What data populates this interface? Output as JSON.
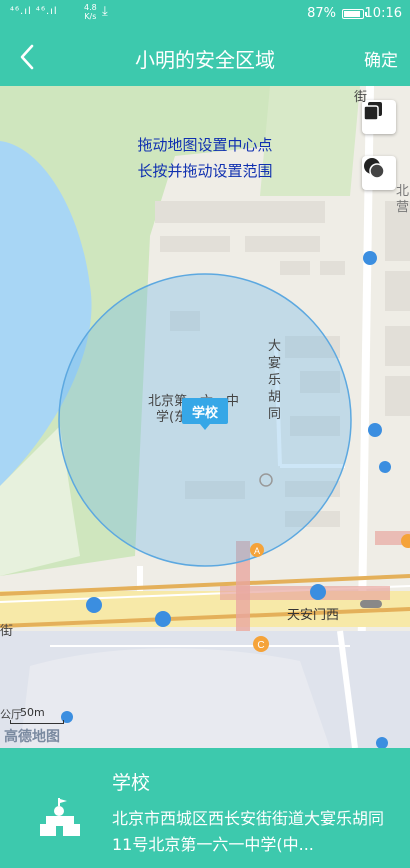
{
  "status_bar": {
    "signal": "⁴⁶.ıl ⁴⁶.ıl",
    "net_speed": "4.8",
    "net_unit": "K/s",
    "battery": "87%",
    "time": "10:16"
  },
  "header": {
    "back_icon": "<",
    "title": "小明的安全区域",
    "confirm": "确定"
  },
  "map": {
    "hint_line1": "拖动地图设置中心点",
    "hint_line2": "长按并拖动设置范围",
    "school_label": "学校",
    "poi_name_line1": "北京第一六一中",
    "poi_name_line2": "学(东)",
    "street_vertical": "大宴乐胡同",
    "street_main": "天安门西",
    "street_left": "街",
    "top_right_label": "街",
    "right_label": "北",
    "right_label2": "营",
    "bottom_left_label": "公厅",
    "scale_text": "50m",
    "logo": "高德地图",
    "circle_color": "#6fb6e8"
  },
  "panel": {
    "name": "学校",
    "address": "北京市西城区西长安街街道大宴乐胡同11号北京第一六一中学(中..."
  }
}
